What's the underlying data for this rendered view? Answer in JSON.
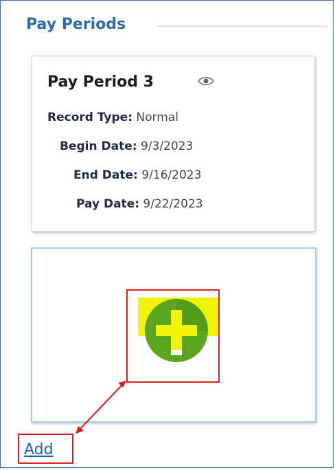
{
  "section": {
    "title": "Pay Periods"
  },
  "card": {
    "title": "Pay Period 3",
    "icon": "eye-icon",
    "fields": {
      "record_type_label": "Record Type:",
      "record_type_value": "Normal",
      "begin_date_label": "Begin Date:",
      "begin_date_value": "9/3/2023",
      "end_date_label": "End Date:",
      "end_date_value": "9/16/2023",
      "pay_date_label": "Pay Date:",
      "pay_date_value": "9/22/2023"
    }
  },
  "add_card": {
    "icon": "plus-circle-icon"
  },
  "add_link": {
    "label": "Add"
  },
  "colors": {
    "accent": "#2f6ba8",
    "annotation": "#d61f1f",
    "icon_green": "#5aa51e",
    "icon_highlight": "#f2f205"
  }
}
